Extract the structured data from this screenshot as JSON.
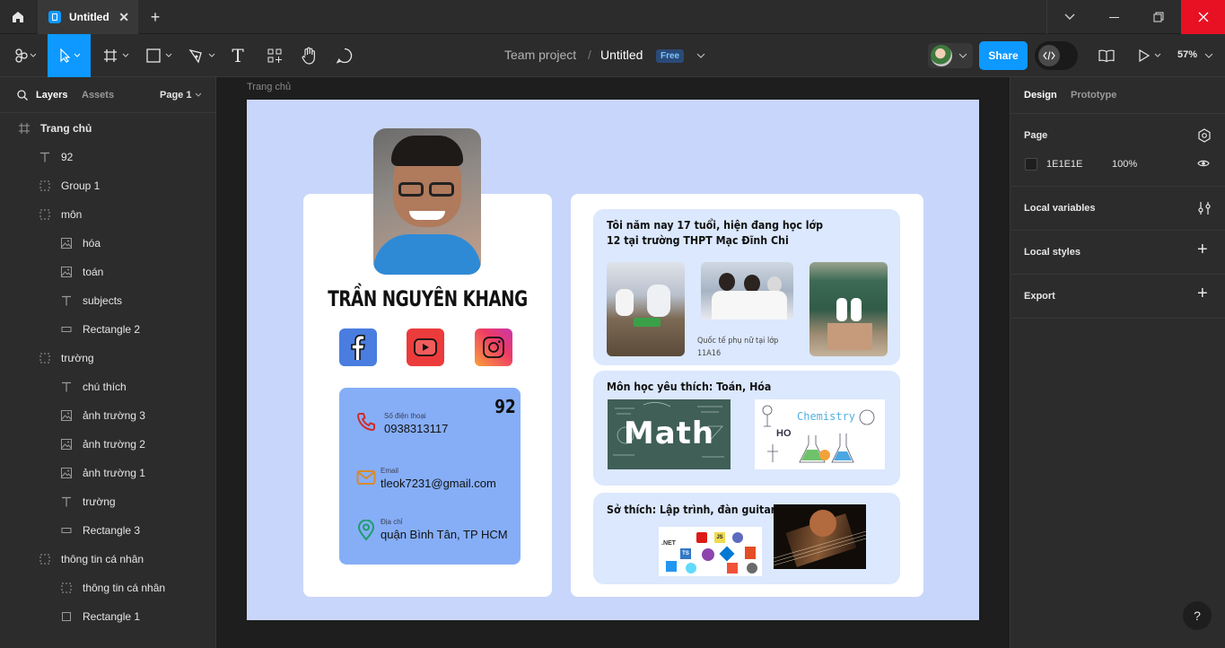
{
  "titlebar": {
    "tab_title": "Untitled",
    "icons": [
      "home-icon",
      "figma-file-icon",
      "close-icon",
      "plus-icon",
      "chevron-down-icon",
      "minimize-icon",
      "restore-icon",
      "window-close-icon"
    ]
  },
  "toolbar": {
    "breadcrumb_team": "Team project",
    "breadcrumb_sep": "/",
    "file_name": "Untitled",
    "plan_badge": "Free",
    "share_label": "Share",
    "zoom": "57%",
    "accent": "#0d99ff"
  },
  "left_panel": {
    "tab_layers": "Layers",
    "tab_assets": "Assets",
    "page_selector": "Page 1",
    "layers": [
      {
        "name": "Trang chủ",
        "icon": "frame-icon"
      },
      {
        "name": "92",
        "icon": "text-icon"
      },
      {
        "name": "Group 1",
        "icon": "group-icon"
      },
      {
        "name": "môn",
        "icon": "group-icon"
      },
      {
        "name": "hóa",
        "icon": "image-icon"
      },
      {
        "name": "toán",
        "icon": "image-icon"
      },
      {
        "name": "subjects",
        "icon": "text-icon"
      },
      {
        "name": "Rectangle 2",
        "icon": "rectangle-icon"
      },
      {
        "name": "trường",
        "icon": "group-icon"
      },
      {
        "name": "chú thích",
        "icon": "text-icon"
      },
      {
        "name": "ảnh trường 3",
        "icon": "image-icon"
      },
      {
        "name": "ảnh trường 2",
        "icon": "image-icon"
      },
      {
        "name": "ảnh trường 1",
        "icon": "image-icon"
      },
      {
        "name": "trường",
        "icon": "text-icon"
      },
      {
        "name": "Rectangle 3",
        "icon": "rectangle-icon"
      },
      {
        "name": "thông tin cá nhân",
        "icon": "group-icon"
      },
      {
        "name": "thông tin cá nhân",
        "icon": "group-icon"
      },
      {
        "name": "Rectangle 1",
        "icon": "frame-rect-icon"
      }
    ]
  },
  "right_panel": {
    "tab_design": "Design",
    "tab_prototype": "Prototype",
    "page_label": "Page",
    "page_color": "1E1E1E",
    "page_opacity": "100%",
    "local_variables": "Local variables",
    "local_styles": "Local styles",
    "export": "Export",
    "help": "?"
  },
  "canvas": {
    "frame_label": "Trang chủ",
    "frame_bg": "#c9d6fb",
    "profile": {
      "name": "TRẦN NGUYÊN KHANG",
      "number": "92",
      "phone_label": "Số điện thoại",
      "phone": "0938313117",
      "email_label": "Email",
      "email": "tleok7231@gmail.com",
      "address_label": "Địa chỉ",
      "address": "quận Bình Tân, TP HCM",
      "social_icons": [
        "facebook-icon",
        "youtube-icon",
        "instagram-icon"
      ]
    },
    "school": {
      "text_line1": "Tôi năm nay 17 tuổi, hiện đang học lớp",
      "text_line2": "12 tại trường THPT Mạc Đĩnh Chi",
      "caption_line1": "Quốc tế phụ nữ tại lớp",
      "caption_line2": "11A16"
    },
    "subjects": {
      "title": "Môn học yêu thích: Toán, Hóa",
      "math_word": "Math",
      "chem_word": "Chemistry",
      "chem_formula": "HO"
    },
    "hobbies": {
      "title": "Sở thích: Lập trình, đàn guitar",
      "net_label": ".NET",
      "js_label": "JS",
      "ts_label": "TS"
    }
  }
}
